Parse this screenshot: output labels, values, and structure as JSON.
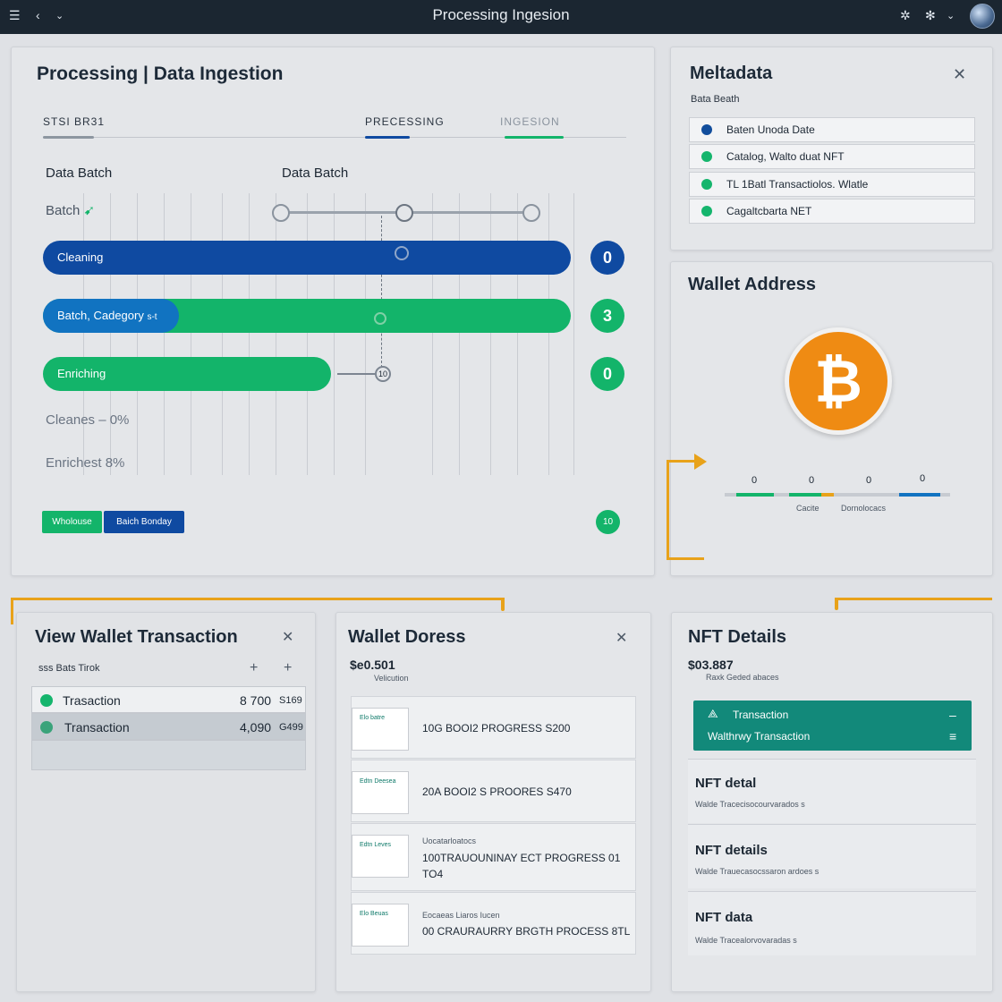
{
  "topbar": {
    "title": "Processing Ingesion"
  },
  "processing": {
    "title": "Processing | Data Ingestion",
    "tabs": [
      "STSI  BR31",
      "PRECESSING",
      "INGESION"
    ],
    "col_labels": [
      "Data Batch",
      "Data Batch"
    ],
    "row_label": "Batch",
    "bars": [
      {
        "label": "Cleaning",
        "count": "0"
      },
      {
        "label": "Batch, Cadegory",
        "label_suffix": "s-t",
        "count": "3"
      },
      {
        "label": "Enriching",
        "count": "0"
      }
    ],
    "bar_fractions": [
      0.62,
      0.62,
      0.38
    ],
    "stats": [
      "Cleanes – 0%",
      "Enrichest  8%"
    ],
    "marker_labels": [
      "0",
      "0",
      "10"
    ],
    "buttons": [
      "Wholouse",
      "Baich Bonday"
    ],
    "badge": "10",
    "colors": {
      "blue": "#0f4aa1",
      "green": "#13b46a",
      "bar_blue2": "#1173c1"
    }
  },
  "metadata": {
    "title": "Meltadata",
    "subtitle": "Bata Beath",
    "items": [
      {
        "text": "Baten Unoda Date",
        "dot": "#114d9c"
      },
      {
        "text": "Catalog, Walto duat NFT",
        "dot": "#15b56d"
      },
      {
        "text": "TL 1Batl Transactiolos. Wlatle",
        "dot": "#15b56d"
      },
      {
        "text": "Cagaltcbarta NET",
        "dot": "#15b56d"
      }
    ]
  },
  "wallet_address": {
    "title": "Wallet Address",
    "coin": "bitcoin-icon",
    "metrics": [
      "0",
      "0",
      "0",
      "0"
    ],
    "metric_labels": [
      "Cacite",
      "Dornolocacs"
    ]
  },
  "view_wallet": {
    "title": "View Wallet Transaction",
    "subtitle": "sss  Bats Tirok",
    "rows": [
      {
        "label": "Trasaction",
        "amount": "8 700",
        "extra": "S169"
      },
      {
        "label": "Transaction",
        "amount": "4,090",
        "extra": "G499"
      }
    ]
  },
  "wallet_doress": {
    "title": "Wallet Doress",
    "amount": "$e0.501",
    "sub": "Velicution",
    "cards": [
      {
        "thumb": "Elo batre",
        "text": "10G BOOI2 PROGRESS S200",
        "sub": ""
      },
      {
        "thumb": "Edtn Deesea",
        "text": "20A BOOI2 S PROORES S470",
        "sub": ""
      },
      {
        "thumb": "Edtn Leves",
        "text": "100TRAUOUNINAY ECT PROGRESS 01 TO4",
        "sub": "Uocatarloatocs"
      },
      {
        "thumb": "Elo Beuas",
        "text": "00 CRAURAURRY BRGTH PROCESS 8TL",
        "sub": "Eocaeas Liaros Iucen"
      }
    ]
  },
  "nft": {
    "title": "NFT Details",
    "amount": "$03.887",
    "sub": "Raxk Geded abaces",
    "banner_lines": [
      "Transaction",
      "Walthrwy Transaction"
    ],
    "items": [
      {
        "title": "NFT detal",
        "sub": "Walde Tracecisocourvarados s"
      },
      {
        "title": "NFT details",
        "sub": "Walde Trauecasocssaron ardoes s"
      },
      {
        "title": "NFT data",
        "sub": "Walde Tracealorvovaradas s"
      }
    ]
  }
}
